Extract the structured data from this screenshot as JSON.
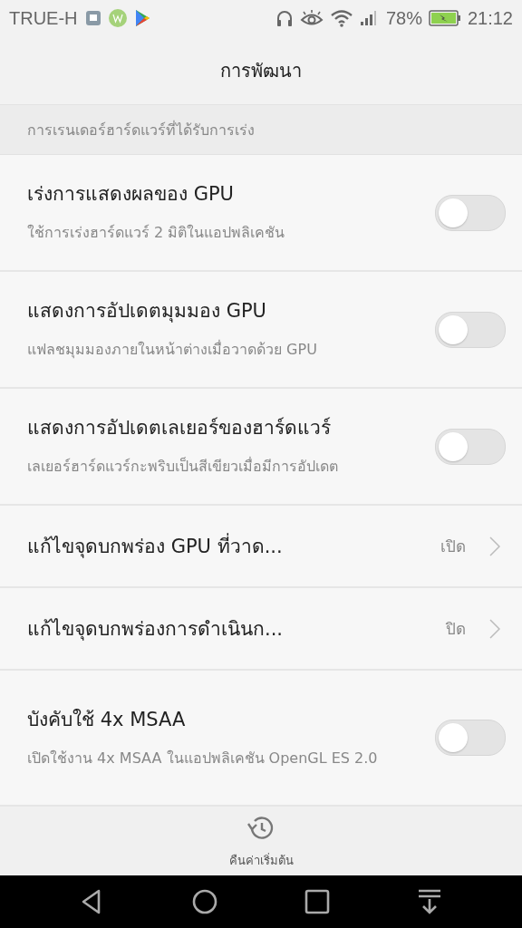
{
  "status_bar": {
    "carrier": "TRUE-H",
    "battery": "78%",
    "time": "21:12"
  },
  "header": {
    "title": "การพัฒนา"
  },
  "section": {
    "title": "การเรนเดอร์ฮาร์ดแวร์ที่ได้รับการเร่ง"
  },
  "rows": [
    {
      "kind": "toggle",
      "title": "เร่งการแสดงผลของ GPU",
      "subtitle": "ใช้การเร่งฮาร์ดแวร์ 2 มิติในแอปพลิเคชัน",
      "on": false
    },
    {
      "kind": "toggle",
      "title": "แสดงการอัปเดตมุมมอง GPU",
      "subtitle": "แฟลชมุมมองภายในหน้าต่างเมื่อวาดด้วย GPU",
      "on": false
    },
    {
      "kind": "toggle",
      "title": "แสดงการอัปเดตเลเยอร์ของฮาร์ดแวร์",
      "subtitle": "เลเยอร์ฮาร์ดแวร์กะพริบเป็นสีเขียวเมื่อมีการอัปเดต",
      "on": false
    },
    {
      "kind": "link",
      "title": "แก้ไขจุดบกพร่อง GPU ที่วาด...",
      "value": "เปิด"
    },
    {
      "kind": "link",
      "title": "แก้ไขจุดบกพร่องการดำเนินก...",
      "value": "ปิด"
    },
    {
      "kind": "toggle",
      "title": "บังคับใช้ 4x MSAA",
      "subtitle": "เปิดใช้งาน 4x MSAA ในแอปพลิเคชัน OpenGL ES 2.0",
      "on": false
    }
  ],
  "bottom_action": {
    "label": "คืนค่าเริ่มต้น"
  }
}
